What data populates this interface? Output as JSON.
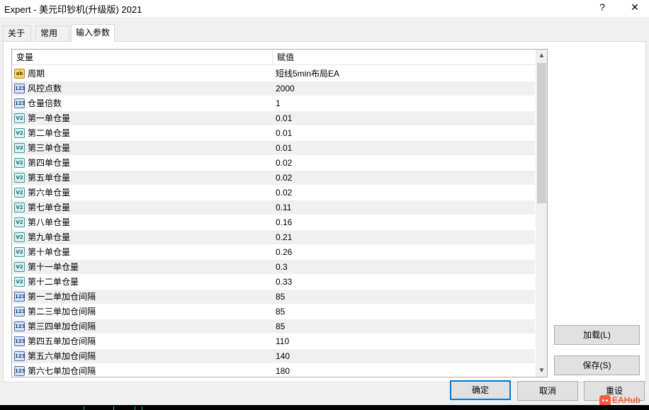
{
  "window": {
    "title": "Expert - 美元印钞机(升级版) 2021",
    "help_label": "?",
    "close_label": "✕"
  },
  "tabs": [
    {
      "label": "关于"
    },
    {
      "label": "常用"
    },
    {
      "label": "输入参数",
      "active": true
    }
  ],
  "grid": {
    "col_variable": "变量",
    "col_value": "赋值",
    "rows": [
      {
        "type": "string",
        "icon": "ab",
        "name": "周期",
        "value": "短线5min布局EA"
      },
      {
        "type": "int",
        "icon": "123",
        "name": "风控点数",
        "value": "2000"
      },
      {
        "type": "int",
        "icon": "123",
        "name": "仓量倍数",
        "value": "1"
      },
      {
        "type": "double",
        "icon": "V2",
        "name": "第一单仓量",
        "value": "0.01"
      },
      {
        "type": "double",
        "icon": "V2",
        "name": "第二单仓量",
        "value": "0.01"
      },
      {
        "type": "double",
        "icon": "V2",
        "name": "第三单仓量",
        "value": "0.01"
      },
      {
        "type": "double",
        "icon": "V2",
        "name": "第四单仓量",
        "value": "0.02"
      },
      {
        "type": "double",
        "icon": "V2",
        "name": "第五单仓量",
        "value": "0.02"
      },
      {
        "type": "double",
        "icon": "V2",
        "name": "第六单仓量",
        "value": "0.02"
      },
      {
        "type": "double",
        "icon": "V2",
        "name": "第七单仓量",
        "value": "0.11"
      },
      {
        "type": "double",
        "icon": "V2",
        "name": "第八单仓量",
        "value": "0.16"
      },
      {
        "type": "double",
        "icon": "V2",
        "name": "第九单仓量",
        "value": "0.21"
      },
      {
        "type": "double",
        "icon": "V2",
        "name": "第十单仓量",
        "value": "0.26"
      },
      {
        "type": "double",
        "icon": "V2",
        "name": "第十一单仓量",
        "value": "0.3"
      },
      {
        "type": "double",
        "icon": "V2",
        "name": "第十二单仓量",
        "value": "0.33"
      },
      {
        "type": "int",
        "icon": "123",
        "name": "第一二单加仓间隔",
        "value": "85"
      },
      {
        "type": "int",
        "icon": "123",
        "name": "第二三单加仓间隔",
        "value": "85"
      },
      {
        "type": "int",
        "icon": "123",
        "name": "第三四单加仓间隔",
        "value": "85"
      },
      {
        "type": "int",
        "icon": "123",
        "name": "第四五单加仓间隔",
        "value": "110"
      },
      {
        "type": "int",
        "icon": "123",
        "name": "第五六单加仓间隔",
        "value": "140"
      },
      {
        "type": "int",
        "icon": "123",
        "name": "第六七单加仓间隔",
        "value": "180"
      }
    ],
    "scroll_up": "▲",
    "scroll_down": "▼"
  },
  "buttons": {
    "load": "加载(L)",
    "save": "保存(S)",
    "ok": "确定",
    "cancel": "取消",
    "reset": "重设"
  },
  "watermark": {
    "text": "EAHub"
  }
}
